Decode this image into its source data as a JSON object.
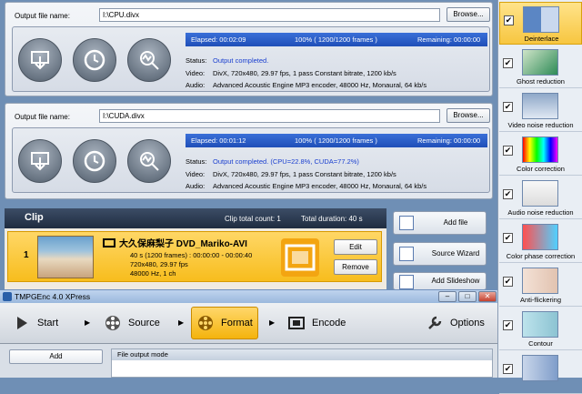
{
  "encode_panels": [
    {
      "output_label": "Output file name:",
      "output_value": "I:\\CPU.divx",
      "browse_label": "Browse...",
      "elapsed": "Elapsed: 00:02:09",
      "progress_text": "100% ( 1200/1200  frames )",
      "remaining": "Remaining: 00:00:00",
      "status_label": "Status:",
      "status_value": "Output completed.",
      "video_label": "Video:",
      "video_value": "DivX,  720x480, 29.97 fps, 1 pass Constant bitrate, 1200 kb/s",
      "audio_label": "Audio:",
      "audio_value": "Advanced Acoustic Engine MP3 encoder, 48000  Hz, Monaural, 64 kb/s"
    },
    {
      "output_label": "Output file name:",
      "output_value": "I:\\CUDA.divx",
      "browse_label": "Browse...",
      "elapsed": "Elapsed: 00:01:12",
      "progress_text": "100% ( 1200/1200  frames )",
      "remaining": "Remaining: 00:00:00",
      "status_label": "Status:",
      "status_value": "Output completed.    (CPU=22.8%, CUDA=77.2%)",
      "video_label": "Video:",
      "video_value": "DivX,  720x480, 29.97 fps, 1 pass Constant bitrate, 1200 kb/s",
      "audio_label": "Audio:",
      "audio_value": "Advanced Acoustic Engine MP3 encoder, 48000  Hz, Monaural, 64 kb/s"
    }
  ],
  "clip": {
    "header": "Clip",
    "total_count": "Clip total count: 1",
    "total_duration": "Total duration: 40 s",
    "number": "1",
    "title": "大久保麻梨子 DVD_Mariko-AVI",
    "line1": "40 s (1200 frames) : 00:00:00 - 00:00:40",
    "line2": "720x480,   29.97  fps",
    "line3": "48000  Hz,  1 ch",
    "edit_label": "Edit",
    "remove_label": "Remove"
  },
  "side_buttons": {
    "add_file": "Add file",
    "source_wizard": "Source Wizard",
    "add_slideshow": "Add Slideshow"
  },
  "window": {
    "title": "TMPGEnc 4.0 XPress",
    "minimize": "–",
    "maximize": "□",
    "close": "✕"
  },
  "stages": {
    "start": "Start",
    "source": "Source",
    "format": "Format",
    "encode": "Encode",
    "options": "Options"
  },
  "bottom": {
    "add_label": "Add",
    "file_output_mode": "File output mode"
  },
  "filters": [
    {
      "label": "Deinterlace",
      "checked": true,
      "selected": true
    },
    {
      "label": "Ghost reduction",
      "checked": true,
      "selected": false
    },
    {
      "label": "Video noise reduction",
      "checked": true,
      "selected": false
    },
    {
      "label": "Color correction",
      "checked": true,
      "selected": false
    },
    {
      "label": "Audio noise reduction",
      "checked": true,
      "selected": false
    },
    {
      "label": "Color phase correction",
      "checked": true,
      "selected": false
    },
    {
      "label": "Anti-flickering",
      "checked": true,
      "selected": false
    },
    {
      "label": "Contour",
      "checked": true,
      "selected": false
    },
    {
      "label": "",
      "checked": true,
      "selected": false
    }
  ],
  "colors": {
    "progress": "#2a5fd0",
    "active_stage": "#f4b30d",
    "clip_row": "#f7bd1d"
  }
}
